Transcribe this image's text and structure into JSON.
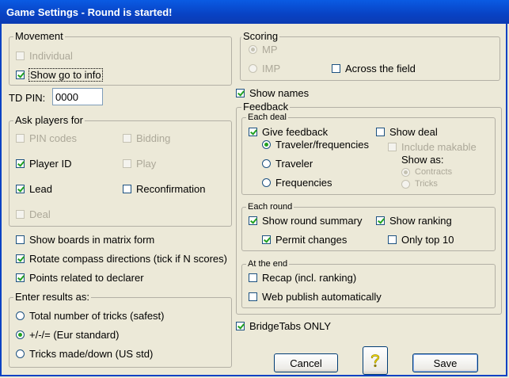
{
  "window": {
    "title": "Game Settings - Round is started!"
  },
  "movement": {
    "legend": "Movement",
    "individual": "Individual",
    "show_go_to_info": "Show go to info"
  },
  "td_pin": {
    "label": "TD PIN:",
    "value": "0000"
  },
  "ask_players": {
    "legend": "Ask players for",
    "pin_codes": "PIN codes",
    "bidding": "Bidding",
    "player_id": "Player ID",
    "play": "Play",
    "lead": "Lead",
    "reconfirmation": "Reconfirmation",
    "deal": "Deal"
  },
  "options": {
    "show_boards_matrix": "Show boards in matrix form",
    "rotate_compass": "Rotate compass directions (tick if N scores)",
    "points_declarer": "Points related to declarer"
  },
  "enter_results": {
    "legend": "Enter results as:",
    "total_tricks": "Total number of tricks (safest)",
    "plus_minus": "+/-/= (Eur standard)",
    "tricks_made": "Tricks made/down (US std)"
  },
  "scoring": {
    "legend": "Scoring",
    "mp": "MP",
    "imp": "IMP",
    "across_field": "Across the field"
  },
  "show_names": "Show names",
  "feedback": {
    "legend": "Feedback",
    "each_deal": {
      "legend": "Each deal",
      "give_feedback": "Give feedback",
      "traveler_frequencies": "Traveler/frequencies",
      "traveler": "Traveler",
      "frequencies": "Frequencies",
      "show_deal": "Show deal",
      "include_makable": "Include makable",
      "show_as": "Show as:",
      "contracts": "Contracts",
      "tricks": "Tricks"
    },
    "each_round": {
      "legend": "Each round",
      "show_round_summary": "Show round summary",
      "show_ranking": "Show ranking",
      "permit_changes": "Permit changes",
      "only_top_10": "Only top 10"
    },
    "at_the_end": {
      "legend": "At the end",
      "recap": "Recap (incl. ranking)",
      "web_publish": "Web publish automatically"
    }
  },
  "bridgetabs_only": "BridgeTabs ONLY",
  "buttons": {
    "cancel": "Cancel",
    "help_icon": "question-mark-icon",
    "save": "Save"
  }
}
